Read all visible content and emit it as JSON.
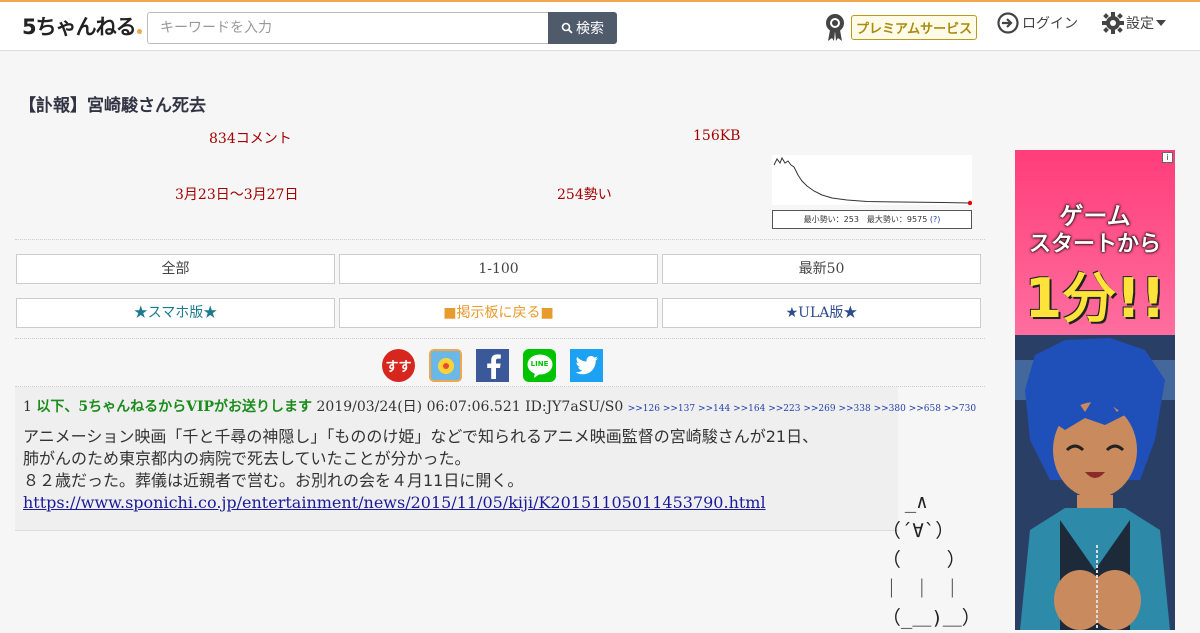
{
  "header": {
    "logo_text": "5ちゃんねる",
    "search_placeholder": "キーワードを入力",
    "search_button": "検索",
    "premium_label": "プレミアムサービス",
    "login_label": "ログイン",
    "settings_label": "設定"
  },
  "thread": {
    "title": "【訃報】宮崎駿さん死去",
    "comments": "834コメント",
    "size": "156KB",
    "period": "3月23日〜3月27日",
    "momentum": "254勢い",
    "graph_caption": "最小勢い：253　最大勢い：9575",
    "graph_help": "(?)"
  },
  "nav": {
    "row1": [
      "全部",
      "1-100",
      "最新50"
    ],
    "row2": [
      "★スマホ版★",
      "■掲示板に戻る■",
      "★ULA版★"
    ]
  },
  "share": {
    "icons": [
      "susu-icon",
      "bookmark-icon",
      "facebook-icon",
      "line-icon",
      "twitter-icon"
    ],
    "line_text": "LINE",
    "susu_text": "すす"
  },
  "post": {
    "number": "1",
    "name": "以下、5ちゃんねるからVIPがお送りします",
    "date": "2019/03/24(日) 06:07:06.521 ID:JY7aSU/S0",
    "replies": ">>126 >>137 >>144 >>164 >>223 >>269 >>338 >>380 >>658 >>730",
    "body_line1": "アニメーション映画「千と千尋の神隠し」「もののけ姫」などで知られるアニメ映画監督の宮崎駿さんが21日、",
    "body_line2": "肺がんのため東京都内の病院で死去していたことが分かった。",
    "body_line3": "８２歳だった。葬儀は近親者で営む。お別れの会を４月11日に開く。",
    "link": "https://www.sponichi.co.jp/entertainment/news/2015/11/05/kiji/K20151105011453790.html"
  },
  "ascii_art": "    _∧\n  （´∀`）\n  （    ）\n  ｜ ｜ ｜\n  （_＿)＿）",
  "ad": {
    "info": "i",
    "line1": "ゲーム",
    "line2": "スタートから",
    "line3": "1分!!"
  },
  "colors": {
    "accent_orange": "#f0a64a",
    "meta_red": "#a40000",
    "post_name_green": "#1b8c1b",
    "search_button_bg": "#4f5a6b"
  }
}
